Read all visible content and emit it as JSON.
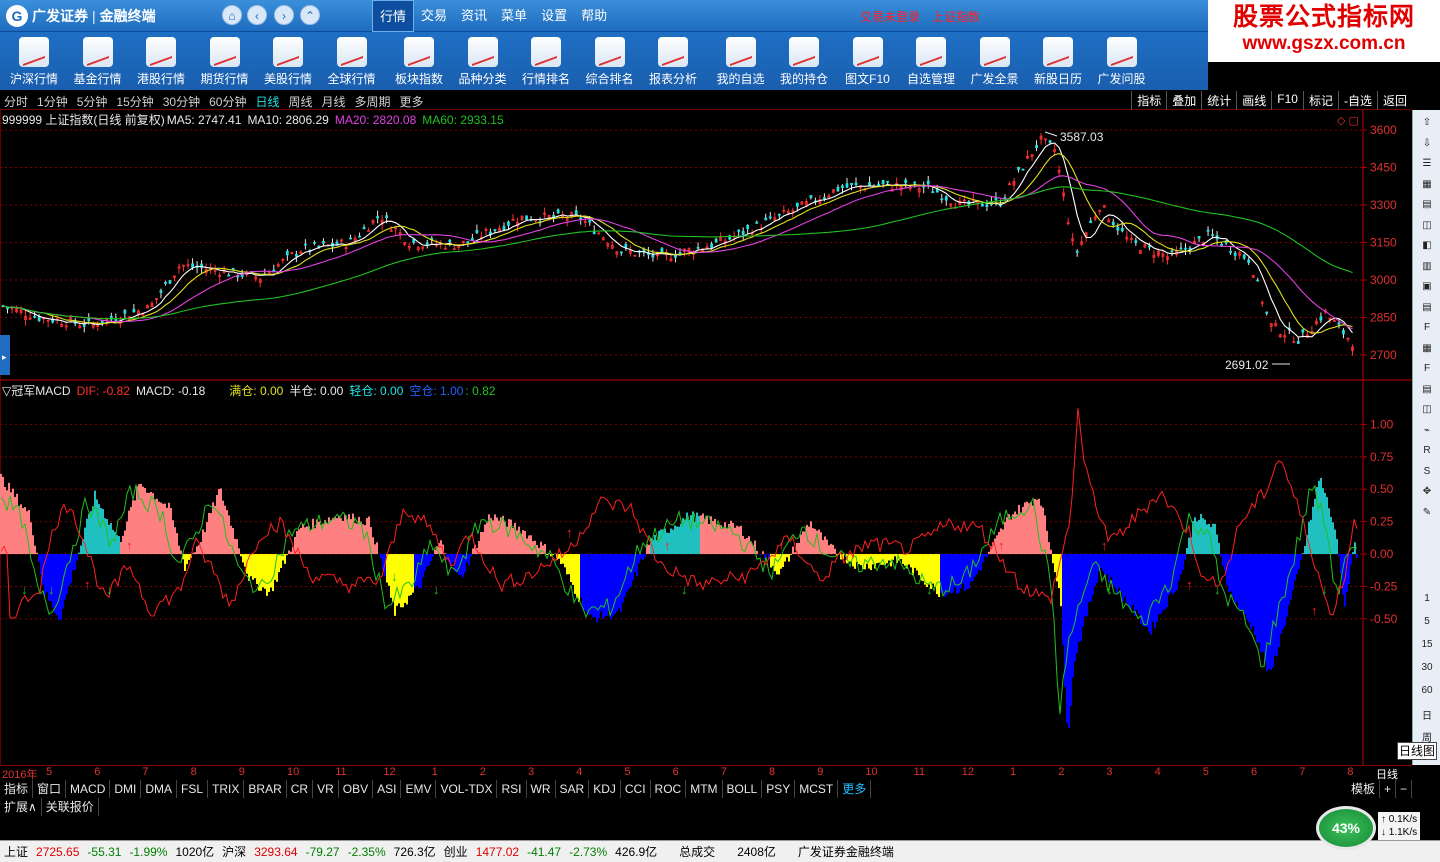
{
  "app": {
    "logo_text": "广发证券",
    "product": "金融终端"
  },
  "menu": [
    "行情",
    "交易",
    "资讯",
    "菜单",
    "设置",
    "帮助"
  ],
  "header": {
    "login": "交易未登录",
    "index": "上证指数"
  },
  "brand": {
    "line1": "股票公式指标网",
    "line2": "www.gszx.com.cn"
  },
  "toolbar": [
    "沪深行情",
    "基金行情",
    "港股行情",
    "期货行情",
    "美股行情",
    "全球行情",
    "板块指数",
    "品种分类",
    "行情排名",
    "综合排名",
    "报表分析",
    "我的自选",
    "我的持仓",
    "图文F10",
    "自选管理",
    "广发全景",
    "新股日历",
    "广发问股"
  ],
  "periods": [
    "分时",
    "1分钟",
    "5分钟",
    "15分钟",
    "30分钟",
    "60分钟",
    "日线",
    "周线",
    "月线",
    "多周期",
    "更多"
  ],
  "right_tabs": [
    "指标",
    "叠加",
    "统计",
    "画线",
    "F10",
    "标记",
    "-自选",
    "返回"
  ],
  "main_chart": {
    "title": "999999 上证指数(日线 前复权)",
    "ma5": "MA5: 2747.41",
    "ma10": "MA10: 2806.29",
    "ma20": "MA20: 2820.08",
    "ma60": "MA60: 2933.15",
    "high": "3587.03",
    "low": "2691.02",
    "y_ticks": [
      "3600",
      "3450",
      "3300",
      "3150",
      "3000",
      "2850",
      "2700"
    ]
  },
  "sub_chart": {
    "name": "冠军MACD",
    "dif": "DIF: -0.82",
    "macd": "MACD: -0.18",
    "full": "满仓: 0.00",
    "half": "半仓: 0.00",
    "light": "轻仓: 0.00",
    "empty": "空仓: 1.00",
    "extra": ": 0.82",
    "y_ticks": [
      "1.00",
      "0.75",
      "0.50",
      "0.25",
      "0.00",
      "-0.25",
      "-0.50"
    ]
  },
  "side_numbers": [
    "1",
    "5",
    "15",
    "30",
    "60"
  ],
  "side_labels": [
    "日",
    "周",
    "日线图"
  ],
  "xaxis": {
    "start": "2016年",
    "months": [
      "5",
      "6",
      "7",
      "8",
      "9",
      "10",
      "11",
      "12",
      "1",
      "2",
      "3",
      "4",
      "5",
      "6",
      "7",
      "8",
      "9",
      "10",
      "11",
      "12",
      "1",
      "2",
      "3",
      "4",
      "5",
      "6",
      "7",
      "8"
    ],
    "period": "日线"
  },
  "indicator_tabs": [
    "指标",
    "窗口",
    "MACD",
    "DMI",
    "DMA",
    "FSL",
    "TRIX",
    "BRAR",
    "CR",
    "VR",
    "OBV",
    "ASI",
    "EMV",
    "VOL-TDX",
    "RSI",
    "WR",
    "SAR",
    "KDJ",
    "CCI",
    "ROC",
    "MTM",
    "BOLL",
    "PSY",
    "MCST",
    "更多"
  ],
  "template_label": "模板",
  "ext_tabs": [
    "扩展∧",
    "关联报价"
  ],
  "status": [
    {
      "name": "上证",
      "value": "2725.65",
      "chg": "-55.31",
      "pct": "-1.99%",
      "amt": "1020亿"
    },
    {
      "name": "沪深",
      "value": "3293.64",
      "chg": "-79.27",
      "pct": "-2.35%",
      "amt": "726.3亿"
    },
    {
      "name": "创业",
      "value": "1477.02",
      "chg": "-41.47",
      "pct": "-2.73%",
      "amt": "426.9亿"
    }
  ],
  "total": {
    "label": "总成交",
    "value": "2408亿"
  },
  "footer": "广发证券金融终端",
  "speed": {
    "pct": "43%",
    "up": "0.1K/s",
    "down": "1.1K/s"
  },
  "colors": {
    "bg": "#000000",
    "red": "#ff3030",
    "cyan": "#20e0e0",
    "ma20": "#e040e0",
    "ma60": "#20c020",
    "blue": "#0000ff",
    "yellow": "#ffff00"
  }
}
